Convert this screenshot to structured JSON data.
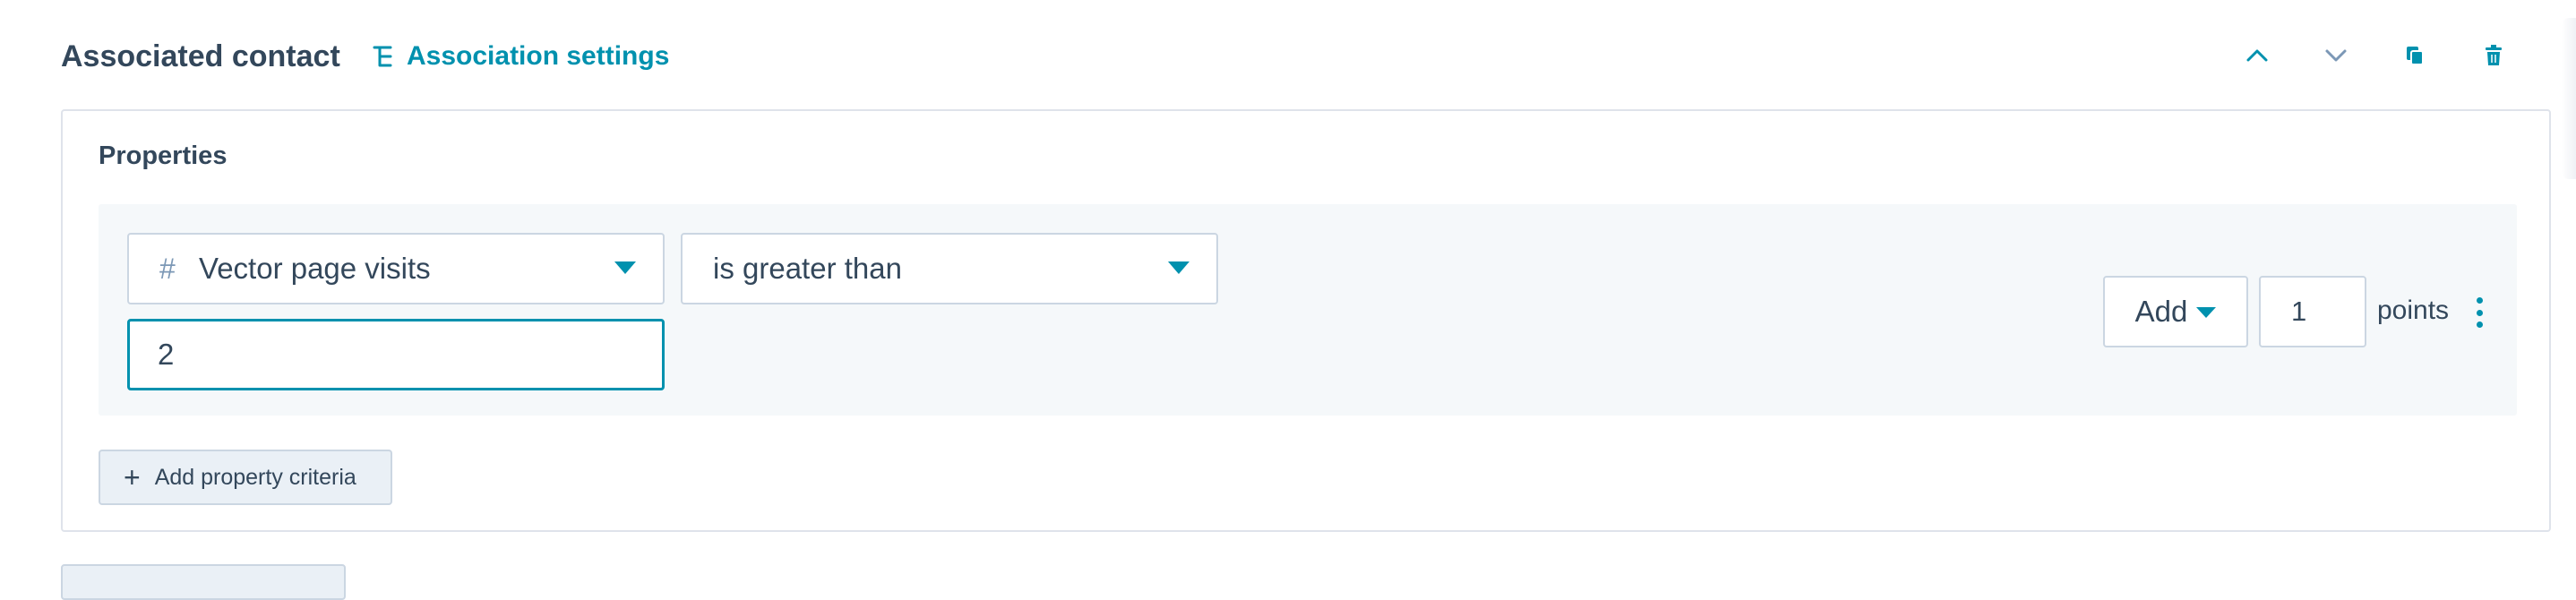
{
  "header": {
    "title": "Associated contact",
    "association_settings_label": "Association settings",
    "actions": [
      {
        "name": "move-up",
        "icon": "chevron-up-icon"
      },
      {
        "name": "move-down",
        "icon": "chevron-down-icon"
      },
      {
        "name": "clone",
        "icon": "copy-icon"
      },
      {
        "name": "delete",
        "icon": "trash-icon"
      }
    ]
  },
  "properties": {
    "title": "Properties",
    "criteria": {
      "property": {
        "type_icon": "#",
        "label": "Vector page visits"
      },
      "operator": {
        "label": "is greater than"
      },
      "value": "2"
    },
    "scoring": {
      "action_label": "Add",
      "points_value": "1",
      "points_label": "points"
    },
    "add_criteria_label": "Add property criteria"
  },
  "colors": {
    "accent": "#0091ae",
    "text": "#33475b",
    "border": "#cbd6e2",
    "panel_bg": "#f5f8fa",
    "button_bg": "#eaf0f6"
  }
}
